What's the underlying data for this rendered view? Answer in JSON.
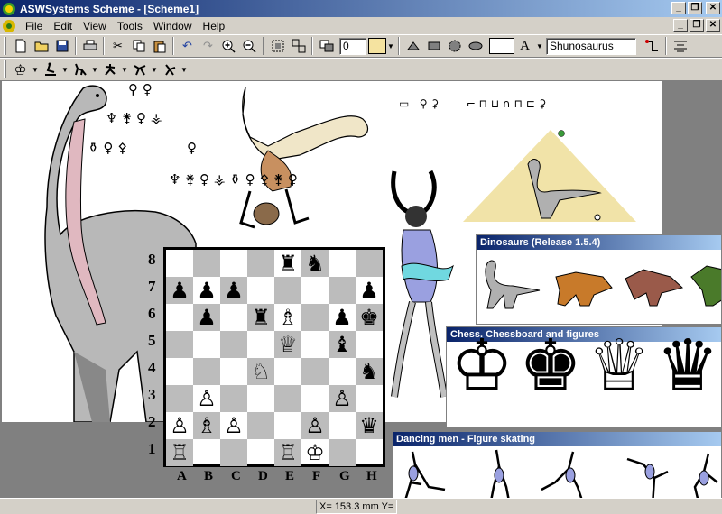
{
  "window": {
    "title": "ASWSystems Scheme - [Scheme1]",
    "min": "_",
    "max": "❐",
    "close": "✕"
  },
  "menu": [
    "File",
    "Edit",
    "View",
    "Tools",
    "Window",
    "Help"
  ],
  "toolbar": {
    "line_width": "0",
    "font_name": "Shunosaurus",
    "font_glyph": "A",
    "fill_color": "#f5e3a0",
    "stroke_color": "#ffffff"
  },
  "chess": {
    "ranks": [
      "8",
      "7",
      "6",
      "5",
      "4",
      "3",
      "2",
      "1"
    ],
    "files": [
      "A",
      "B",
      "C",
      "D",
      "E",
      "F",
      "G",
      "H"
    ],
    "rows": [
      [
        "",
        "",
        "",
        "",
        "♜",
        "♞",
        "",
        ""
      ],
      [
        "♟",
        "♟",
        "♟",
        "",
        "",
        "",
        "",
        "♟"
      ],
      [
        "",
        "♟",
        "",
        "♜",
        "♗",
        "",
        "♟",
        "♚"
      ],
      [
        "",
        "",
        "",
        "",
        "♕",
        "",
        "♝",
        ""
      ],
      [
        "",
        "",
        "",
        "♘",
        "",
        "",
        "",
        "♞"
      ],
      [
        "",
        "♙",
        "",
        "",
        "",
        "",
        "♙",
        ""
      ],
      [
        "♙",
        "♗",
        "♙",
        "",
        "",
        "♙",
        "",
        "♛"
      ],
      [
        "♖",
        "",
        "",
        "",
        "♖",
        "♔",
        "",
        ""
      ]
    ]
  },
  "panels": {
    "dinosaurs": "Dinosaurs (Release 1.5.4)",
    "chess": "Chess. Chessboard and figures",
    "skating": "Dancing men - Figure skating"
  },
  "status": {
    "coords": "X= 153.3 mm Y="
  }
}
